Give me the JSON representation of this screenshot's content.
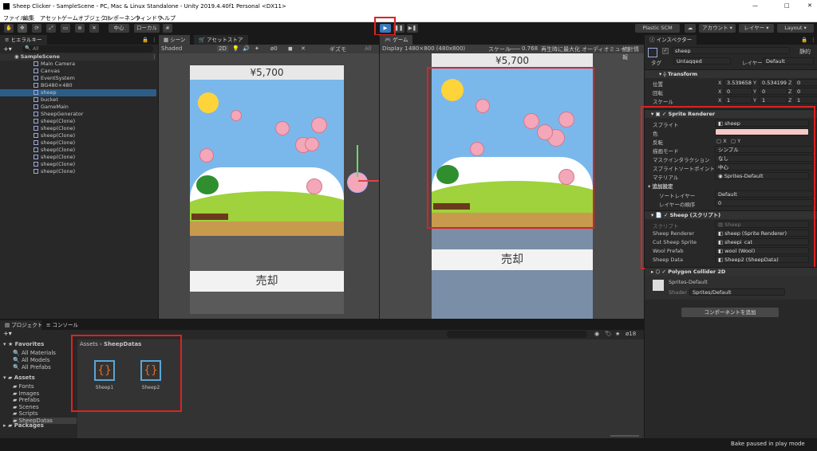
{
  "window": {
    "title": "Sheep Clicker - SampleScene - PC, Mac & Linux Standalone - Unity 2019.4.40f1 Personal <DX11>",
    "controls": [
      "—",
      "□",
      "✕"
    ]
  },
  "menu": [
    "ファイル",
    "編集",
    "アセット",
    "ゲームオブジェクト",
    "コンポーネント",
    "ウィンドウ",
    "ヘルプ"
  ],
  "toolbar": {
    "pivot": "中心",
    "space": "ローカル",
    "plastic": "Plastic SCM",
    "account": "アカウント",
    "layers": "レイヤー",
    "layout": "Layout"
  },
  "hierarchy": {
    "tab": "ヒエラルキー",
    "search_placeholder": "All",
    "scene": "SampleScene",
    "items": [
      "Main Camera",
      "Canvas",
      "EventSystem",
      "BG480×480",
      "sheep",
      "bucket",
      "GameMain",
      "SheepGenerator",
      "sheep(Clone)",
      "sheep(Clone)",
      "sheep(Clone)",
      "sheep(Clone)",
      "sheep(Clone)",
      "sheep(Clone)",
      "sheep(Clone)",
      "sheep(Clone)"
    ]
  },
  "scene_view": {
    "tabs": [
      "シーン",
      "アセットストア"
    ],
    "shading": "Shaded",
    "mode": "2D",
    "gizmos": "ギズモ",
    "search": "All",
    "money": "¥5,700",
    "sell": "売却"
  },
  "game_view": {
    "tab": "ゲーム",
    "display": "Display 1",
    "resolution": "480×800 (480x800)",
    "scale_label": "スケール",
    "scale_value": "0.768",
    "maximize": "再生時に最大化",
    "mute": "オーディオミュート",
    "stats": "統計情報",
    "money": "¥5,700",
    "sell": "売却"
  },
  "project": {
    "tabs": [
      "プロジェクト",
      "コンソール"
    ],
    "favorites_label": "Favorites",
    "favorites": [
      "All Materials",
      "All Models",
      "All Prefabs"
    ],
    "assets_label": "Assets",
    "folders": [
      "Fonts",
      "Images",
      "Prefabs",
      "Scenes",
      "Scripts",
      "SheepDatas"
    ],
    "packages_label": "Packages",
    "breadcrumb_root": "Assets",
    "breadcrumb_leaf": "SheepDatas",
    "hidden_count": "18",
    "assets": [
      "Sheep1",
      "Sheep2"
    ]
  },
  "inspector": {
    "tab": "インスペクター",
    "name": "sheep",
    "static": "静的",
    "tag_label": "タグ",
    "tag": "Untagged",
    "layer_label": "レイヤー",
    "layer": "Default",
    "transform": {
      "title": "Transform",
      "rows": [
        {
          "label": "位置",
          "x": "3.539658",
          "y": "0.5341992",
          "z": "0"
        },
        {
          "label": "回転",
          "x": "0",
          "y": "0",
          "z": "0"
        },
        {
          "label": "スケール",
          "x": "1",
          "y": "1",
          "z": "1"
        }
      ]
    },
    "sprite_renderer": {
      "title": "Sprite Renderer",
      "sprite_label": "スプライト",
      "sprite": "sheep",
      "color_label": "色",
      "color": "#f6c9c9",
      "flip_label": "反転",
      "flip_x": "X",
      "flip_y": "Y",
      "draw_mode_label": "描画モード",
      "draw_mode": "シンプル",
      "mask_label": "マスクインタラクション",
      "mask": "なし",
      "sort_point_label": "スプライトソートポイント",
      "sort_point": "中心",
      "material_label": "マテリアル",
      "material": "Sprites-Default",
      "additional": "追加設定",
      "sorting_layer_label": "ソートレイヤー",
      "sorting_layer": "Default",
      "order_label": "レイヤーの順序",
      "order": "0"
    },
    "sheep_script": {
      "title": "Sheep (スクリプト)",
      "script_label": "スクリプト",
      "script": "Sheep",
      "fields": [
        {
          "label": "Sheep Renderer",
          "value": "sheep (Sprite Renderer)"
        },
        {
          "label": "Cut Sheep Sprite",
          "value": "sheepi_cat"
        },
        {
          "label": "Wool Prefab",
          "value": "wool (Wool)"
        },
        {
          "label": "Sheep Data",
          "value": "Sheep2 (SheepData)"
        }
      ]
    },
    "polygon_collider": "Polygon Collider 2D",
    "material_name": "Sprites-Default",
    "shader_label": "Shader",
    "shader": "Sprites/Default",
    "add_component": "コンポーネントを追加"
  },
  "status": "Bake paused in play mode",
  "colors": {
    "accent": "#3a79bb",
    "highlight": "#d22222",
    "sky": "#7ab8ec"
  }
}
